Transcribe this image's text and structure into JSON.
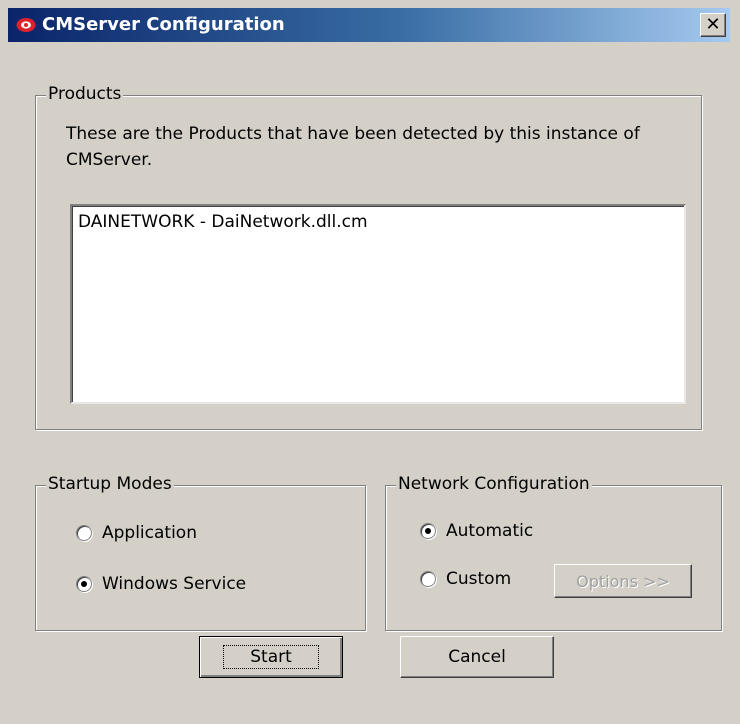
{
  "window": {
    "title": "CMServer Configuration",
    "close_glyph": "✕"
  },
  "products": {
    "legend": "Products",
    "description": "These are the Products that have been detected by this instance of CMServer.",
    "items": [
      "DAINETWORK - DaiNetwork.dll.cm"
    ]
  },
  "startup_modes": {
    "legend": "Startup Modes",
    "options": [
      {
        "label": "Application",
        "checked": false
      },
      {
        "label": "Windows Service",
        "checked": true
      }
    ]
  },
  "network_configuration": {
    "legend": "Network Configuration",
    "options": [
      {
        "label": "Automatic",
        "checked": true
      },
      {
        "label": "Custom",
        "checked": false
      }
    ],
    "options_button": "Options >>"
  },
  "buttons": {
    "start": "Start",
    "cancel": "Cancel"
  },
  "colors": {
    "dialog_bg": "#d4d0c8",
    "titlebar_start": "#0a246a",
    "titlebar_end": "#a6caf0",
    "app_icon": "#e0202a"
  },
  "icons": {
    "app": "eye-logo-icon",
    "close": "close-icon"
  }
}
